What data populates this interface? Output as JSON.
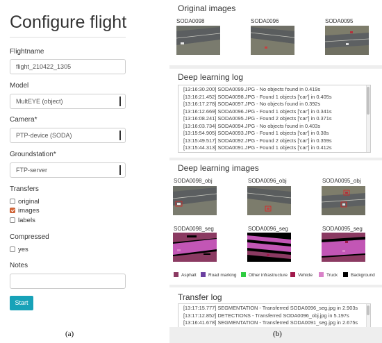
{
  "config": {
    "title": "Configure flight",
    "flightname_label": "Flightname",
    "flightname_value": "flight_210422_1305",
    "model_label": "Model",
    "model_value": "MultEYE (object)",
    "camera_label": "Camera*",
    "camera_value": "PTP-device (SODA)",
    "groundstation_label": "Groundstation*",
    "groundstation_value": "FTP-server",
    "transfers_label": "Transfers",
    "transfers": [
      {
        "label": "original",
        "checked": false
      },
      {
        "label": "images",
        "checked": true
      },
      {
        "label": "labels",
        "checked": false
      }
    ],
    "compressed_label": "Compressed",
    "compressed_option": "yes",
    "notes_label": "Notes",
    "notes_value": "",
    "start_label": "Start",
    "caption": "(a)"
  },
  "panel": {
    "caption": "(b)",
    "original_title": "Original images",
    "original_images": [
      "SODA0098",
      "SODA0096",
      "SODA0095"
    ],
    "dl_log_title": "Deep learning log",
    "dl_log": [
      "[13:16:30.200] SODA0099.JPG - No objects found in 0.419s",
      "[13:16:21.452] SODA0098.JPG - Found 1 objects ['car'] in 0.405s",
      "[13:16:17.278] SODA0097.JPG - No objects found in 0.392s",
      "[13:16:12.669] SODA0096.JPG - Found 1 objects ['car'] in 0.341s",
      "[13:16:08.241] SODA0095.JPG - Found 2 objects ['car'] in 0.371s",
      "[13:16:03.734] SODA0094.JPG - No objects found in 0.403s",
      "[13:15:54.905] SODA0093.JPG - Found 1 objects ['car'] in 0.38s",
      "[13:15:49.517] SODA0092.JPG - Found 2 objects ['car'] in 0.359s",
      "[13:15:44.313] SODA0091.JPG - Found 1 objects ['car'] in 0.412s"
    ],
    "dl_images_title": "Deep learning images",
    "obj_images": [
      "SODA0098_obj",
      "SODA0096_obj",
      "SODA0095_obj"
    ],
    "seg_images": [
      "SODA0098_seg",
      "SODA0096_seg",
      "SODA0095_seg"
    ],
    "legend": [
      {
        "label": "Asphalt",
        "color": "#8b3a62"
      },
      {
        "label": "Road marking",
        "color": "#6b3fa0"
      },
      {
        "label": "Other infrastructure",
        "color": "#2ecc40"
      },
      {
        "label": "Vehicle",
        "color": "#a0184a"
      },
      {
        "label": "Truck",
        "color": "#d982c8"
      },
      {
        "label": "Background",
        "color": "#000000"
      }
    ],
    "transfer_log_title": "Transfer log",
    "transfer_log": [
      "[13:17:15.777] SEGMENTATION - Transferred SODA0096_seg.jpg in 2.903s",
      "[13:17:12.852] DETECTIONS - Transferred SODA0096_obj.jpg in 5.197s",
      "[13:16:41.678] SEGMENTATION - Transferred SODA0091_seg.jpg in 2.675s"
    ]
  }
}
